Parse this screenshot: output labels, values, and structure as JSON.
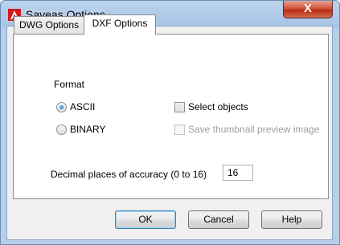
{
  "window": {
    "title": "Saveas Options",
    "close_label": "X"
  },
  "tabs": [
    {
      "label": "DWG Options",
      "active": false
    },
    {
      "label": "DXF Options",
      "active": true
    }
  ],
  "format_group": {
    "legend": "Format",
    "options": [
      {
        "label": "ASCII",
        "selected": true
      },
      {
        "label": "BINARY",
        "selected": false
      }
    ]
  },
  "checkboxes": [
    {
      "label": "Select objects",
      "checked": false,
      "enabled": true
    },
    {
      "label": "Save thumbnail preview image",
      "checked": false,
      "enabled": false
    }
  ],
  "decimal": {
    "label": "Decimal places of accuracy (0 to 16)",
    "value": "16"
  },
  "buttons": {
    "ok": "OK",
    "cancel": "Cancel",
    "help": "Help"
  },
  "colors": {
    "title_bar": "#b7cfe9",
    "close_button": "#c8432a",
    "app_icon": "#d11b1b",
    "dialog_bg": "#f0f0f0"
  }
}
